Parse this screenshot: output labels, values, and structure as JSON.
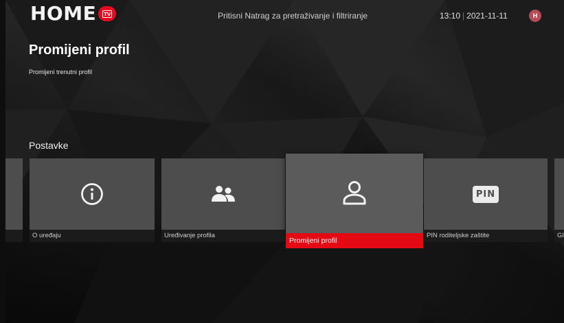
{
  "header": {
    "logo_text": "HOME",
    "logo_badge": "TV",
    "hint": "Pritisni Natrag za pretraživanje i filtriranje",
    "time": "13:10",
    "date": "2021-11-11",
    "avatar_initial": "H"
  },
  "page": {
    "title": "Promijeni profil",
    "subtitle": "Promijeni trenutni profil"
  },
  "section": {
    "title": "Postavke"
  },
  "cards": [
    {
      "label": "",
      "icon": "none"
    },
    {
      "label": "O uređaju",
      "icon": "info-icon"
    },
    {
      "label": "Uređivanje profila",
      "icon": "people-icon"
    },
    {
      "label": "Promijeni profil",
      "icon": "person-icon",
      "selected": true
    },
    {
      "label": "PIN roditeljske zaštite",
      "icon": "pin-icon",
      "badge": "PIN"
    },
    {
      "label": "Gl",
      "icon": "none"
    }
  ],
  "colors": {
    "accent": "#e50914",
    "card_bg": "#4d4d4d",
    "avatar_bg": "#b54a58"
  }
}
